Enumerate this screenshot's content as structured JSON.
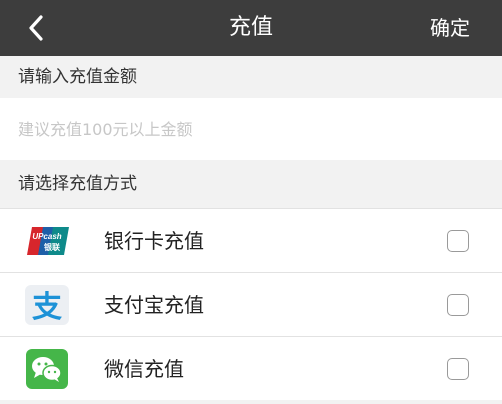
{
  "header": {
    "title": "充值",
    "confirm_label": "确定"
  },
  "amount": {
    "section_label": "请输入充值金额",
    "placeholder": "建议充值100元以上金额",
    "value": ""
  },
  "methods": {
    "section_label": "请选择充值方式",
    "items": [
      {
        "label": "银行卡充值",
        "icon": "unionpay-icon",
        "checked": false
      },
      {
        "label": "支付宝充值",
        "icon": "alipay-icon",
        "checked": false
      },
      {
        "label": "微信充值",
        "icon": "wechat-icon",
        "checked": false
      }
    ]
  },
  "icons": {
    "unionpay_text": "UPcash",
    "unionpay_subtext": "银联",
    "alipay_glyph": "支"
  },
  "colors": {
    "nav_bg": "#3d3d3d",
    "unionpay_red": "#d7262c",
    "unionpay_blue": "#1e5fa8",
    "unionpay_teal": "#0e8a8a",
    "alipay_blue": "#1d92d7",
    "wechat_green": "#45b649"
  }
}
